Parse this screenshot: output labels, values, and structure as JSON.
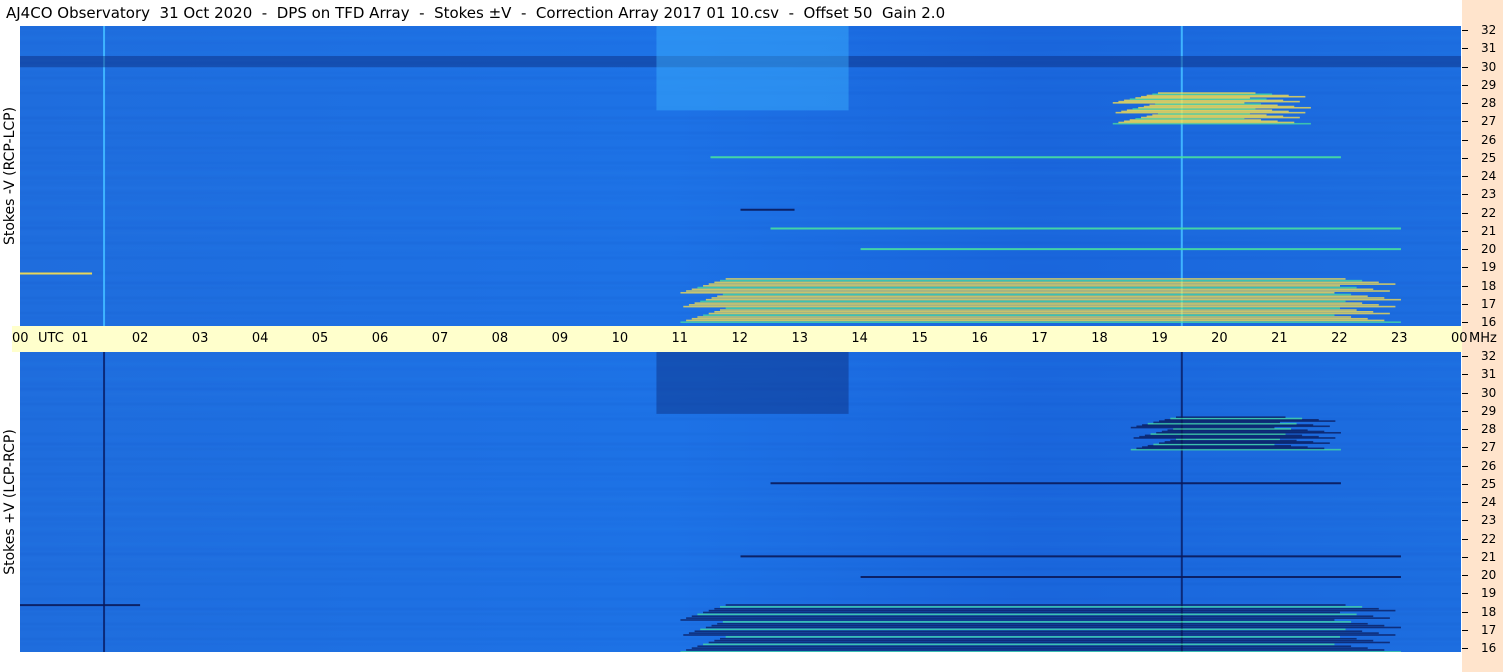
{
  "title": "AJ4CO Observatory  31 Oct 2020  -  DPS on TFD Array  -  Stokes ±V  -  Correction Array 2017 01 10.csv  -  Offset 50  Gain 2.0",
  "colors": {
    "background_blue": "#1d6ee0",
    "axis_strip": "#ffffcc",
    "right_strip": "#ffe4cc",
    "emission_hot": "#ffe24a",
    "emission_warm": "#48e0a0",
    "emission_cold": "#0a1a5a"
  },
  "chart_data": [
    {
      "type": "heatmap",
      "ylabel": "Stokes -V (RCP-LCP)",
      "xlabel": "UTC",
      "xticks": [
        "00",
        "01",
        "02",
        "03",
        "04",
        "05",
        "06",
        "07",
        "08",
        "09",
        "10",
        "11",
        "12",
        "13",
        "14",
        "15",
        "16",
        "17",
        "18",
        "19",
        "20",
        "21",
        "22",
        "23",
        "00"
      ],
      "xlim": [
        0,
        24
      ],
      "y_unit": "MHz",
      "yticks": [
        16,
        17,
        18,
        19,
        20,
        21,
        22,
        23,
        24,
        25,
        26,
        27,
        28,
        29,
        30,
        31,
        32
      ],
      "ylim": [
        16,
        32
      ],
      "features": [
        {
          "kind": "vertical_line",
          "time": 1.4,
          "tone": "bright"
        },
        {
          "kind": "vertical_line",
          "time": 19.35,
          "tone": "bright"
        },
        {
          "kind": "band",
          "t0": 0,
          "t1": 24,
          "f0": 29.8,
          "f1": 30.4,
          "tone": "dark"
        },
        {
          "kind": "band",
          "t0": 10.6,
          "t1": 13.8,
          "f0": 27.5,
          "f1": 32,
          "tone": "bright"
        },
        {
          "kind": "emission",
          "t0": 18.2,
          "t1": 21.5,
          "f0": 26.8,
          "f1": 28.5,
          "tone": "hot"
        },
        {
          "kind": "emission",
          "t0": 11.0,
          "t1": 23.0,
          "f0": 16.2,
          "f1": 18.6,
          "tone": "hot"
        },
        {
          "kind": "line",
          "t0": 0,
          "t1": 1.2,
          "f": 18.8,
          "tone": "hot"
        },
        {
          "kind": "line",
          "t0": 12.5,
          "t1": 23.0,
          "f": 21.2,
          "tone": "warm"
        },
        {
          "kind": "line",
          "t0": 14.0,
          "t1": 23.0,
          "f": 20.1,
          "tone": "warm"
        },
        {
          "kind": "line",
          "t0": 11.5,
          "t1": 22.0,
          "f": 25.0,
          "tone": "warm"
        },
        {
          "kind": "line",
          "t0": 12.0,
          "t1": 12.9,
          "f": 22.2,
          "tone": "cold"
        }
      ]
    },
    {
      "type": "heatmap",
      "ylabel": "Stokes +V (LCP-RCP)",
      "xlabel": "UTC",
      "xticks": [
        "00",
        "01",
        "02",
        "03",
        "04",
        "05",
        "06",
        "07",
        "08",
        "09",
        "10",
        "11",
        "12",
        "13",
        "14",
        "15",
        "16",
        "17",
        "18",
        "19",
        "20",
        "21",
        "22",
        "23",
        "00"
      ],
      "xlim": [
        0,
        24
      ],
      "y_unit": "MHz",
      "yticks": [
        16,
        17,
        18,
        19,
        20,
        21,
        22,
        23,
        24,
        25,
        26,
        27,
        28,
        29,
        30,
        31,
        32
      ],
      "ylim": [
        16,
        32
      ],
      "features": [
        {
          "kind": "vertical_line",
          "time": 1.4,
          "tone": "dark"
        },
        {
          "kind": "vertical_line",
          "time": 19.35,
          "tone": "dark"
        },
        {
          "kind": "band",
          "t0": 10.6,
          "t1": 13.8,
          "f0": 28.7,
          "f1": 32,
          "tone": "dark"
        },
        {
          "kind": "emission",
          "t0": 18.5,
          "t1": 22.0,
          "f0": 26.8,
          "f1": 28.6,
          "tone": "cold"
        },
        {
          "kind": "emission",
          "t0": 11.0,
          "t1": 23.0,
          "f0": 16.0,
          "f1": 18.6,
          "tone": "cold"
        },
        {
          "kind": "line",
          "t0": 0,
          "t1": 2.0,
          "f": 18.5,
          "tone": "cold"
        },
        {
          "kind": "line",
          "t0": 12.0,
          "t1": 23.0,
          "f": 21.1,
          "tone": "cold"
        },
        {
          "kind": "line",
          "t0": 14.0,
          "t1": 23.0,
          "f": 20.0,
          "tone": "cold"
        },
        {
          "kind": "line",
          "t0": 12.5,
          "t1": 22.0,
          "f": 25.0,
          "tone": "cold"
        }
      ]
    }
  ],
  "axis": {
    "utc_label": "UTC",
    "mhz_label": "MHz"
  }
}
